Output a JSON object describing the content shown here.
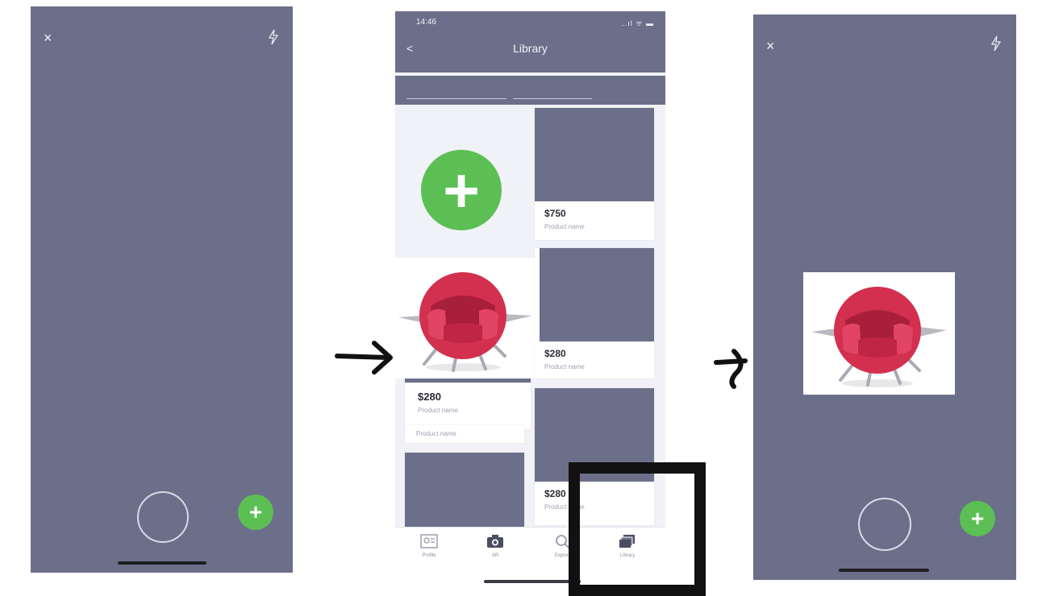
{
  "left_screen": {
    "close_label": "×",
    "add_label": "+"
  },
  "middle_screen": {
    "status_time": "14:46",
    "status_icons": "..ıl ᯤ ▬",
    "back_label": "<",
    "title": "Library",
    "add_label": "+",
    "cards": [
      {
        "price": "$750",
        "name": "Product name"
      },
      {
        "price": "$280",
        "name": "Product name"
      },
      {
        "price": "$280",
        "name": "Product name"
      },
      {
        "price": "$280",
        "name": "Product name"
      }
    ],
    "extra_label": "Product name",
    "tabs": [
      {
        "label": "Profile",
        "icon": "profile-icon"
      },
      {
        "label": "AR",
        "icon": "camera-icon"
      },
      {
        "label": "Explore",
        "icon": "explore-icon"
      },
      {
        "label": "Library",
        "icon": "library-icon"
      }
    ]
  },
  "right_screen": {
    "close_label": "×",
    "add_label": "+"
  },
  "colors": {
    "screen": "#6b6f89",
    "accent_green": "#5cbf54",
    "chair_red": "#d3304f"
  }
}
